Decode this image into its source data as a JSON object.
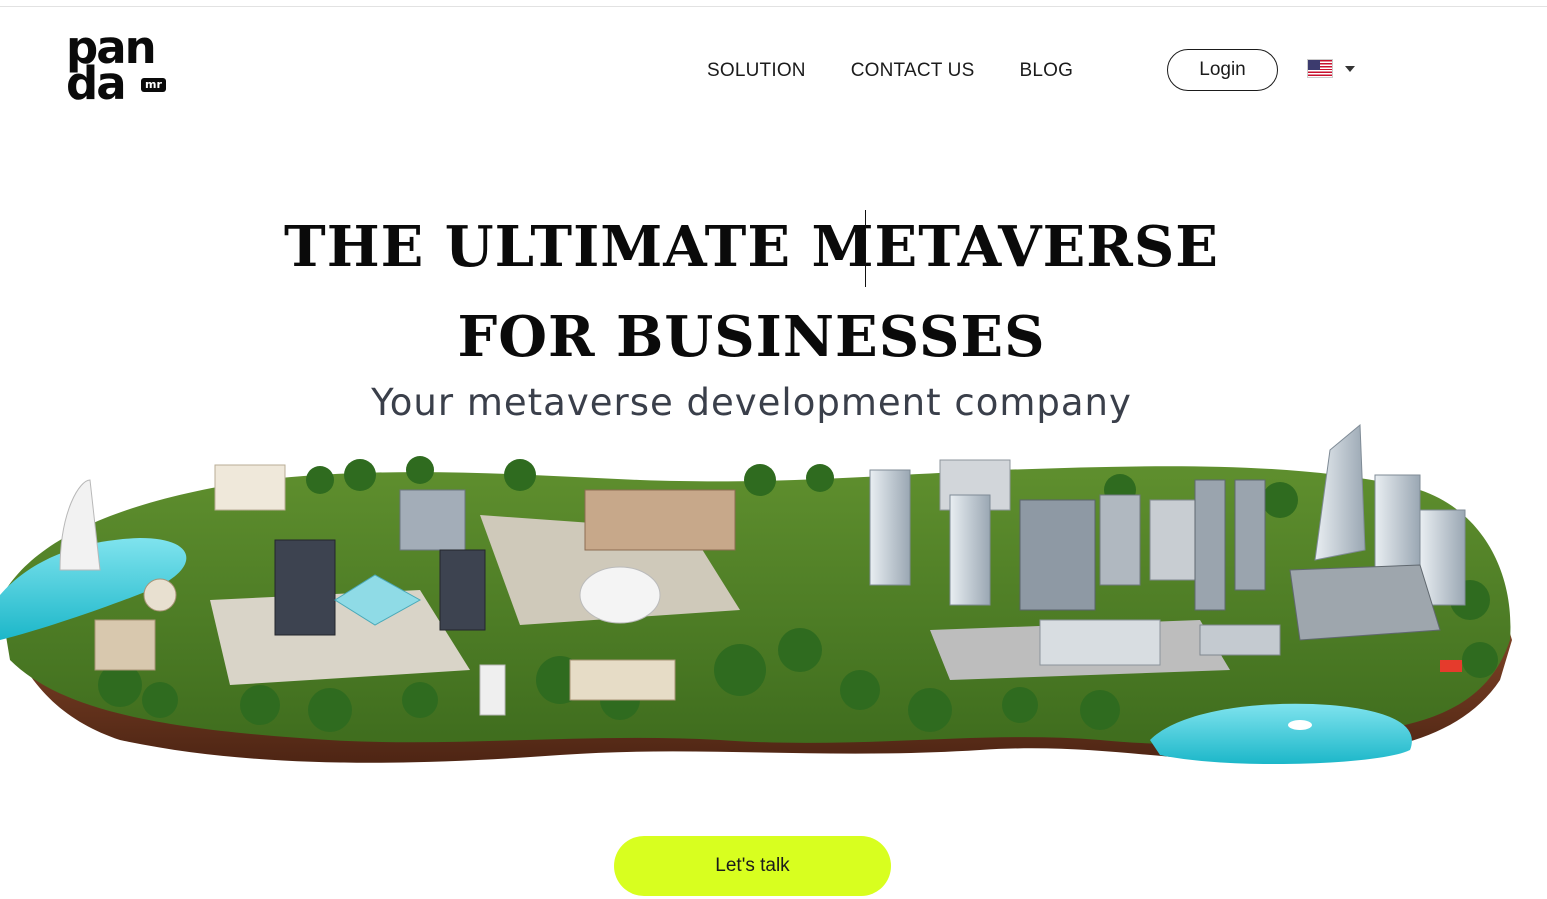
{
  "logo": {
    "line1": "pan",
    "line2": "da",
    "badge": "mr"
  },
  "nav": {
    "items": [
      "SOLUTION",
      "CONTACT US",
      "BLOG"
    ]
  },
  "header": {
    "login_label": "Login",
    "language_icon": "us-flag-icon"
  },
  "hero": {
    "title_line1": "THE ULTIMATE METAVERSE",
    "title_line2": "FOR BUSINESSES",
    "subtitle": "Your metaverse development company",
    "image": "isometric-metaverse-city-island"
  },
  "cta": {
    "label": "Let's talk",
    "color": "#d8ff1f"
  }
}
